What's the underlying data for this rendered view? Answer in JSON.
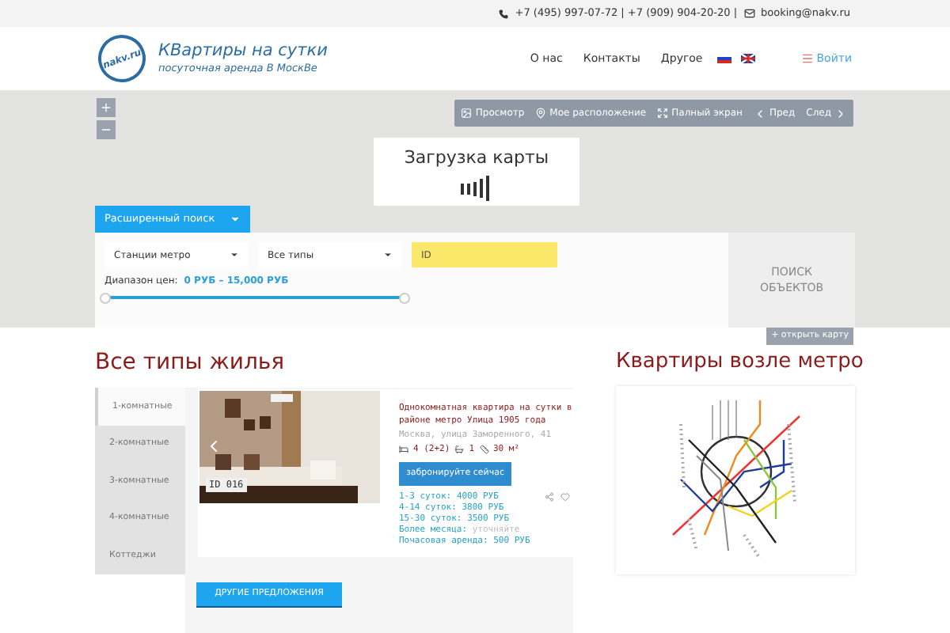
{
  "top_bar": {
    "phones": "+7 (495) 997-07-72 | +7 (909) 904-20-20 |",
    "email": "booking@nakv.ru"
  },
  "header": {
    "logo_text": "nakv.ru",
    "title": "КВартиры на сутки",
    "subtitle": "посуточная аренда В МоскВе",
    "nav": [
      "О нас",
      "Контакты",
      "Другое"
    ],
    "login": "Войти"
  },
  "map": {
    "toolbar": [
      "Просмотр",
      "Мое расположение",
      "Палный экран",
      "Пред",
      "След"
    ],
    "loading": "Загрузка карты",
    "open_map": "+ открыть карту"
  },
  "search": {
    "tab": "Расширенный поиск",
    "selects": [
      "Станции метро",
      "Все типы"
    ],
    "id_placeholder": "ID",
    "price_label": "Диапазон цен:",
    "price_range": "0 РУБ – 15,000 РУБ",
    "level": 1,
    "button": "ПОИСК ОБЪЕКТОВ"
  },
  "listings": {
    "title": "Все типы жилья",
    "tabs": [
      {
        "label": "1-комнатные",
        "selected": true
      },
      {
        "label": "2-комнатные",
        "selected": false
      },
      {
        "label": "3-комнатные",
        "selected": false
      },
      {
        "label": "4-комнатные",
        "selected": false
      },
      {
        "label": "Коттеджи",
        "selected": false
      }
    ],
    "card": {
      "id_badge": "ID 016",
      "title": "Однокомнатная квартира на сутки в районе метро Улица 1905 года",
      "address": "Москва, улица Заморенного, 41",
      "beds": "4 (2+2)",
      "baths": "1",
      "area": "30 м²",
      "book": "забронируйте сейчас",
      "prices": [
        {
          "label": "1-3 суток:",
          "value": "4000 РУБ"
        },
        {
          "label": "4-14 суток:",
          "value": "3800 РУБ"
        },
        {
          "label": "15-30 суток:",
          "value": "3500 РУБ"
        },
        {
          "label": "Более месяца:",
          "value": "уточняйте"
        },
        {
          "label": "Почасовая аренда:",
          "value": "500 РУБ"
        }
      ]
    },
    "more": "ДРУГИЕ ПРЕДЛОЖЕНИЯ"
  },
  "metro": {
    "title": "Квартиры возле метро"
  }
}
